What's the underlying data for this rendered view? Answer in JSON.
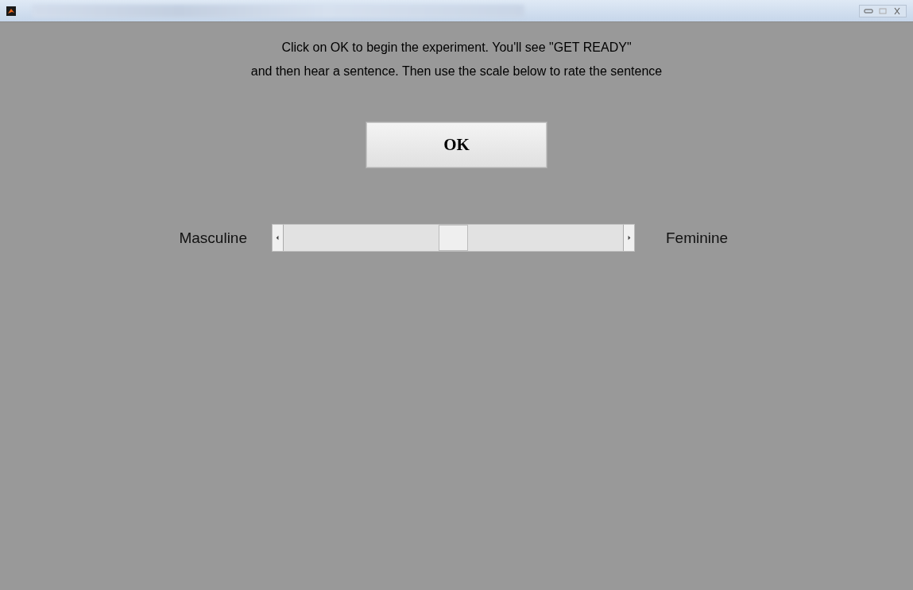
{
  "instructions": [
    "Click on OK to begin the experiment. You'll see \"GET READY\"",
    "and then hear a sentence. Then use the scale below to rate the sentence"
  ],
  "ok_button": {
    "label": "OK"
  },
  "scale": {
    "left_label": "Masculine",
    "right_label": "Feminine",
    "level": 0.5
  }
}
